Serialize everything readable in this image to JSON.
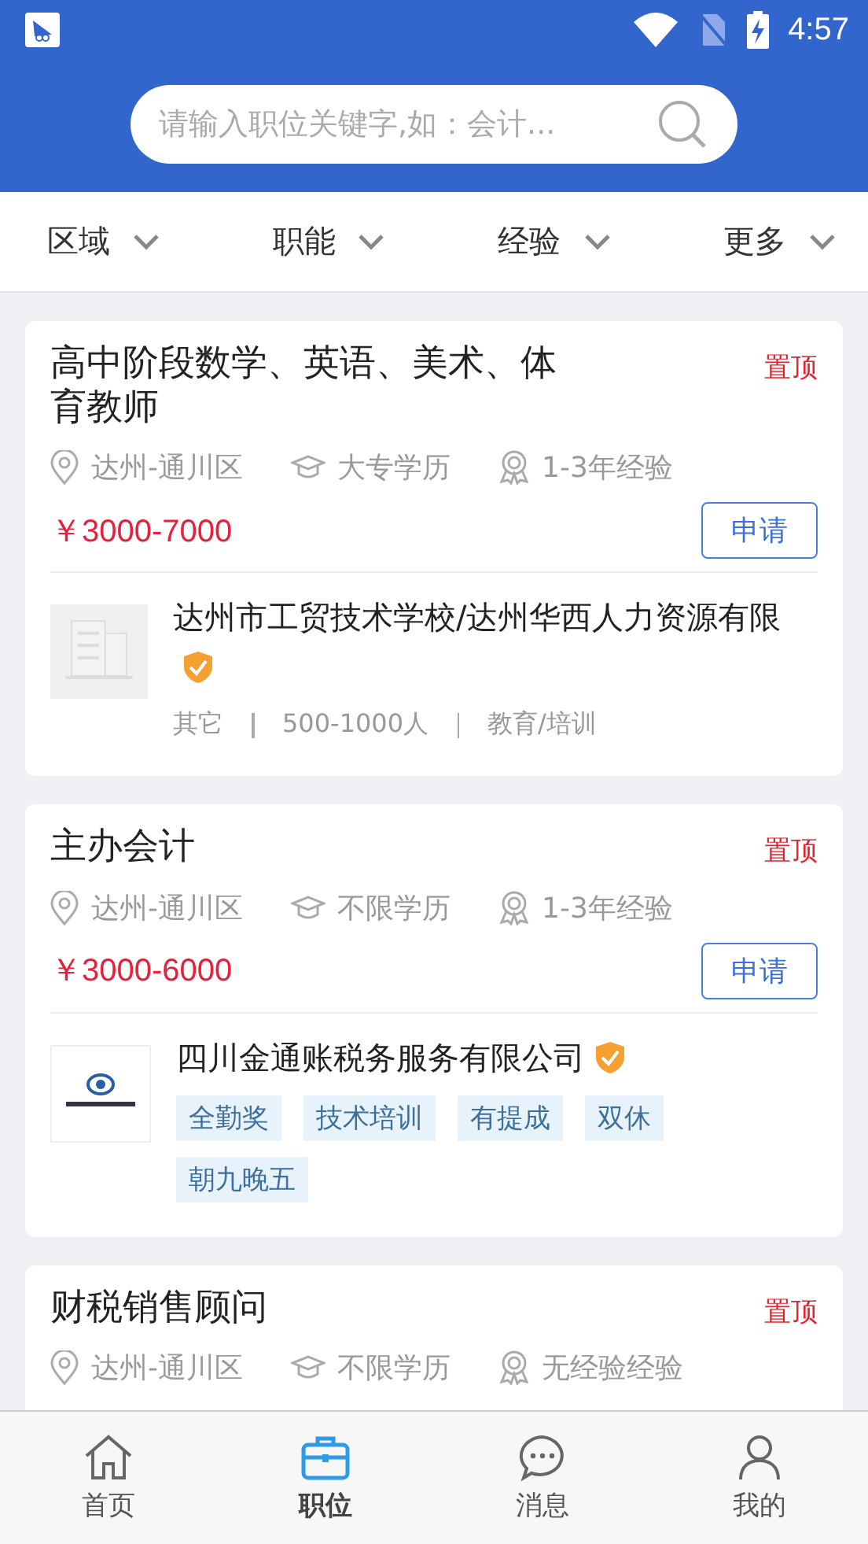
{
  "status_bar": {
    "time": "4:57"
  },
  "search": {
    "placeholder": "请输入职位关键字,如：会计..."
  },
  "filters": [
    {
      "label": "区域"
    },
    {
      "label": "职能"
    },
    {
      "label": "经验"
    },
    {
      "label": "更多"
    }
  ],
  "jobs": [
    {
      "title": "高中阶段数学、英语、美术、体育教师",
      "pinned_label": "置顶",
      "location": "达州-通川区",
      "education": "大专学历",
      "experience": "1-3年经验",
      "salary": "￥3000-7000",
      "apply": "申请",
      "company": {
        "name": "达州市工贸技术学校/达州华西人力资源有限",
        "verified": true,
        "kind": "placeholder",
        "info": [
          "其它",
          "500-1000人",
          "教育/培训"
        ]
      }
    },
    {
      "title": "主办会计",
      "pinned_label": "置顶",
      "location": "达州-通川区",
      "education": "不限学历",
      "experience": "1-3年经验",
      "salary": "￥3000-6000",
      "apply": "申请",
      "company": {
        "name": "四川金通账税务服务有限公司",
        "verified": true,
        "kind": "image",
        "tags": [
          "全勤奖",
          "技术培训",
          "有提成",
          "双休",
          "朝九晚五"
        ]
      }
    },
    {
      "title": "财税销售顾问",
      "pinned_label": "置顶",
      "location": "达州-通川区",
      "education": "不限学历",
      "experience": "无经验经验"
    }
  ],
  "nav": [
    {
      "label": "首页",
      "selected": false,
      "kind": "home"
    },
    {
      "label": "职位",
      "selected": true,
      "kind": "jobs"
    },
    {
      "label": "消息",
      "selected": false,
      "kind": "messages"
    },
    {
      "label": "我的",
      "selected": false,
      "kind": "profile"
    }
  ]
}
